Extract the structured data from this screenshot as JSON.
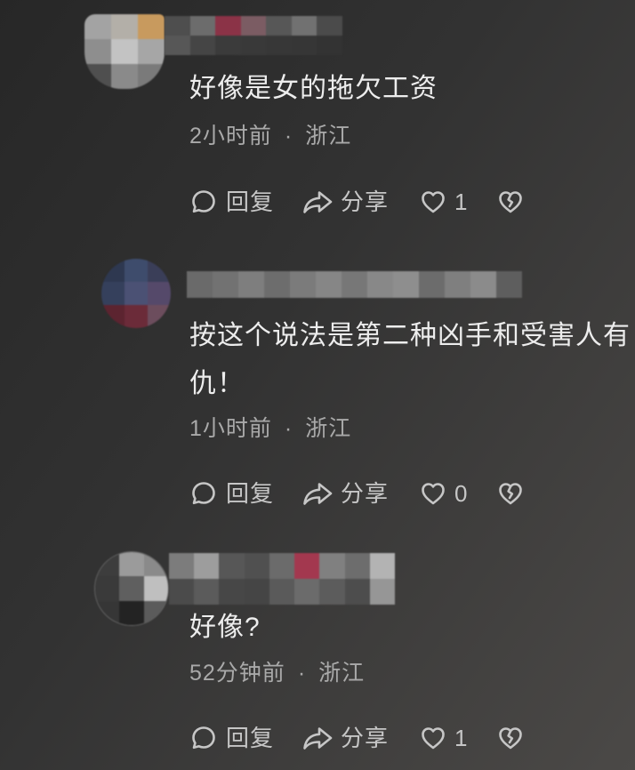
{
  "theme": {
    "bg_from": "#272727",
    "bg_mid": "#323232",
    "bg_to": "#4b4947",
    "text_primary": "#ededed",
    "text_secondary": "#a9a9a9",
    "action_color": "#c6c6c6"
  },
  "meta_separator": "·",
  "actions": {
    "reply_label": "回复",
    "share_label": "分享",
    "icons": {
      "reply": "comment-bubble-icon",
      "share": "share-arrow-icon",
      "like": "heart-icon",
      "dislike": "broken-heart-icon"
    }
  },
  "comments": [
    {
      "text": "好像是女的拖欠工资",
      "time": "2小时前",
      "location": "浙江",
      "like_count": 1,
      "avatar_pixels": [
        [
          "#a3a3a3",
          "#b3afa8",
          "#c89a5e"
        ],
        [
          "#8e8e8e",
          "#c3c3c3",
          "#a6a6a6"
        ],
        [
          "#4f4f4f",
          "#8a8a8a",
          "#7a7a7a"
        ]
      ],
      "name_pixels": [
        [
          "#4e4e4e",
          "#6c6c6c",
          "#8b3347",
          "#7b5c63",
          "#575757",
          "#717171",
          "#4b4b4b"
        ],
        [
          "#575757",
          "#454545",
          "#3b3b3b",
          "#393939",
          "#373737",
          "#363636",
          "#333333"
        ]
      ]
    },
    {
      "text": "按这个说法是第二种凶手和受害人有仇！",
      "time": "1小时前",
      "location": "浙江",
      "like_count": 0,
      "avatar_pixels": [
        [
          "#2e3850",
          "#3e4c6c",
          "#3a3e58"
        ],
        [
          "#35405c",
          "#4b5174",
          "#55496a"
        ],
        [
          "#5c2430",
          "#6b2b39",
          "#6c4d5d"
        ]
      ],
      "name_pixels": [
        [
          "#6a6a6a",
          "#727272",
          "#7e7e7e",
          "#6d6d6d",
          "#7b7b7b",
          "#868686",
          "#777777",
          "#888888",
          "#8e8e8e",
          "#6c6c6c",
          "#7f7f7f",
          "#8b8b8b",
          "#5e5e5e"
        ]
      ]
    },
    {
      "text": "好像?",
      "time": "52分钟前",
      "location": "浙江",
      "like_count": 1,
      "avatar_pixels": [
        [
          "#3d3d3d",
          "#9b9b9b",
          "#8a8a8a"
        ],
        [
          "#3a3a3a",
          "#5f5f5f",
          "#bfbfbf"
        ],
        [
          "#363636",
          "#232323",
          "#5b5b5b"
        ]
      ],
      "name_pixels": [
        [
          "#7c7c7c",
          "#9d9d9d",
          "#575757",
          "#505050",
          "#6b6b6b",
          "#a3384f",
          "#808080",
          "#6d6d6d",
          "#b3b3b3"
        ],
        [
          "#4b4b4b",
          "#5b5b5b",
          "#474747",
          "#454545",
          "#5a5a5a",
          "#6b6b6b",
          "#5c5c5c",
          "#4d4d4d",
          "#969696"
        ]
      ]
    }
  ]
}
